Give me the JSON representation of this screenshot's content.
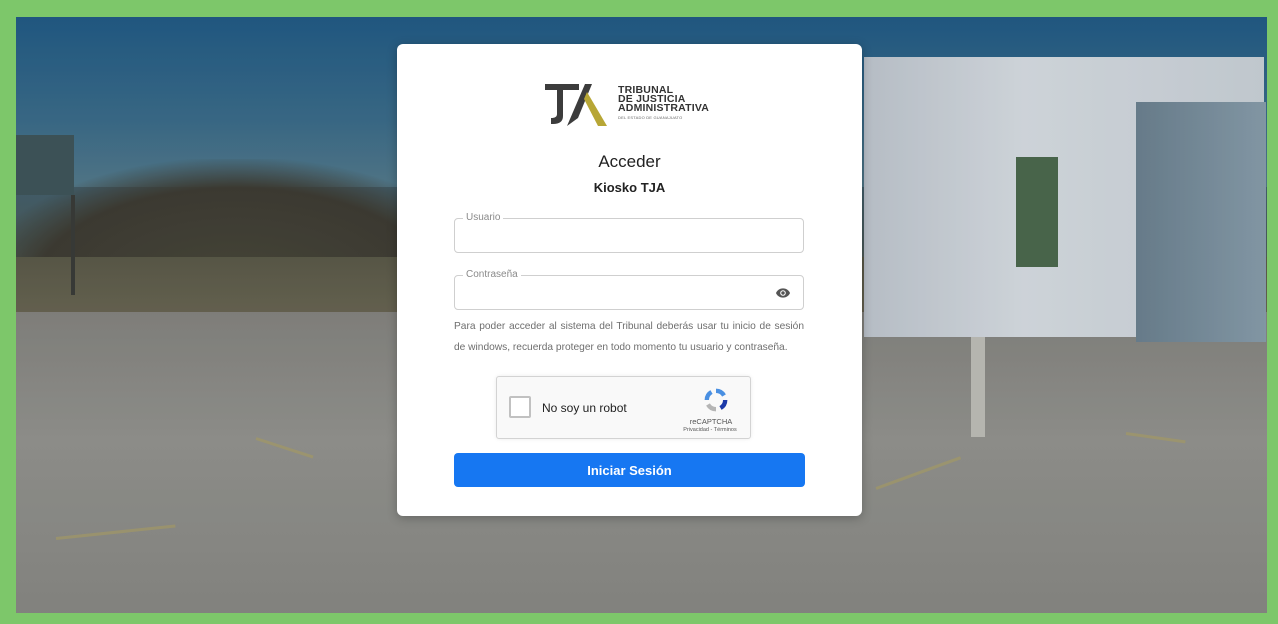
{
  "logo": {
    "line1": "TRIBUNAL",
    "line2": "DE JUSTICIA",
    "line3": "ADMINISTRATIVA",
    "line4": "DEL ESTADO DE GUANAJUATO",
    "mark": "TJA-logo"
  },
  "login": {
    "title": "Acceder",
    "subtitle": "Kiosko TJA",
    "username_label": "Usuario",
    "username_value": "",
    "password_label": "Contraseña",
    "password_value": "",
    "password_icon": "eye-icon",
    "note": "Para poder acceder al sistema del Tribunal deberás usar tu inicio de sesión de windows, recuerda proteger en todo momento tu usuario y contraseña.",
    "submit_label": "Iniciar Sesión"
  },
  "captcha": {
    "label": "No soy un robot",
    "brand": "reCAPTCHA",
    "privacy": "Privacidad",
    "separator": " - ",
    "terms": "Términos"
  },
  "colors": {
    "frame_border": "#7dc76a",
    "primary_button": "#1677f2",
    "logo_gold": "#b7a635",
    "logo_dark": "#3c3c3c"
  }
}
